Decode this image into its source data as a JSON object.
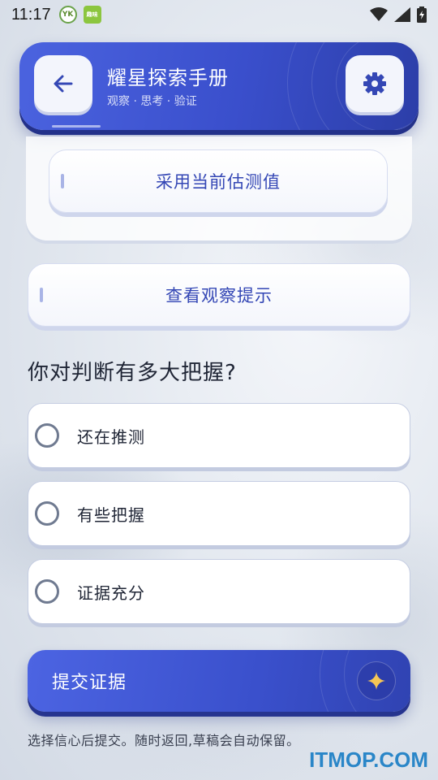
{
  "status_bar": {
    "time": "11:17",
    "notif1_text": "YK",
    "notif2_text": "趣味"
  },
  "header": {
    "title": "耀星探索手册",
    "subtitle": "观察 · 思考 · 验证",
    "back_icon": "arrow-left-icon",
    "settings_icon": "gear-icon",
    "accent": "#3a4fcc"
  },
  "estimate": {
    "use_estimate_label": "采用当前估测值"
  },
  "hint": {
    "view_hint_label": "查看观察提示"
  },
  "confidence": {
    "question": "你对判断有多大把握?",
    "options": [
      {
        "label": "还在推测",
        "selected": false
      },
      {
        "label": "有些把握",
        "selected": false
      },
      {
        "label": "证据充分",
        "selected": false
      }
    ]
  },
  "submit": {
    "label": "提交证据",
    "icon": "sparkle-icon"
  },
  "footnote": "选择信心后提交。随时返回,草稿会自动保留。",
  "watermark": "ITMOP.COM"
}
